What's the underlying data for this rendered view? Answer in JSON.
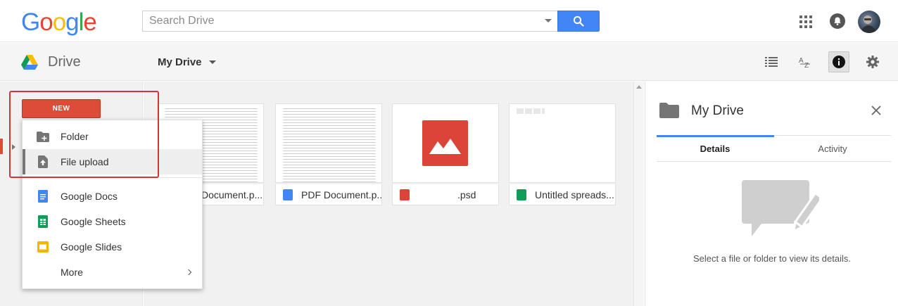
{
  "header": {
    "logo_letters": [
      "G",
      "o",
      "o",
      "g",
      "l",
      "e"
    ],
    "logo_colors": [
      "#4285f4",
      "#ea4335",
      "#fbbc05",
      "#4285f4",
      "#34a853",
      "#ea4335"
    ],
    "search_placeholder": "Search Drive",
    "icons": [
      "apps-grid-icon",
      "notifications-icon",
      "avatar"
    ]
  },
  "subbar": {
    "product_name": "Drive",
    "location_menu": "My Drive",
    "tools": [
      "list-view-icon",
      "sort-az-icon",
      "info-icon",
      "settings-icon"
    ],
    "active_tool": "info-icon"
  },
  "new_menu": {
    "button_label": "NEW",
    "items": [
      {
        "label": "Folder",
        "icon": "new-folder-icon"
      },
      {
        "label": "File upload",
        "icon": "file-upload-icon",
        "hovered": true
      },
      {
        "label": "Google Docs",
        "icon": "google-docs-icon",
        "color": "#4285f4"
      },
      {
        "label": "Google Sheets",
        "icon": "google-sheets-icon",
        "color": "#0f9d58"
      },
      {
        "label": "Google Slides",
        "icon": "google-slides-icon",
        "color": "#f4b400"
      },
      {
        "label": "More",
        "icon": "",
        "submenu": true
      }
    ]
  },
  "files": [
    {
      "name": "Document.p...",
      "icon": "pdf-document-icon",
      "icon_color": "#4285f4"
    },
    {
      "name": "PDF Document.p...",
      "icon": "pdf-document-icon",
      "icon_color": "#4285f4"
    },
    {
      "name": ".psd",
      "icon": "image-file-icon",
      "icon_color": "#db4437"
    },
    {
      "name": "Untitled spreads...",
      "icon": "spreadsheet-file-icon",
      "icon_color": "#0f9d58"
    }
  ],
  "details_panel": {
    "title": "My Drive",
    "tabs": [
      "Details",
      "Activity"
    ],
    "active_tab": "Details",
    "empty_message": "Select a file or folder to view its details."
  }
}
